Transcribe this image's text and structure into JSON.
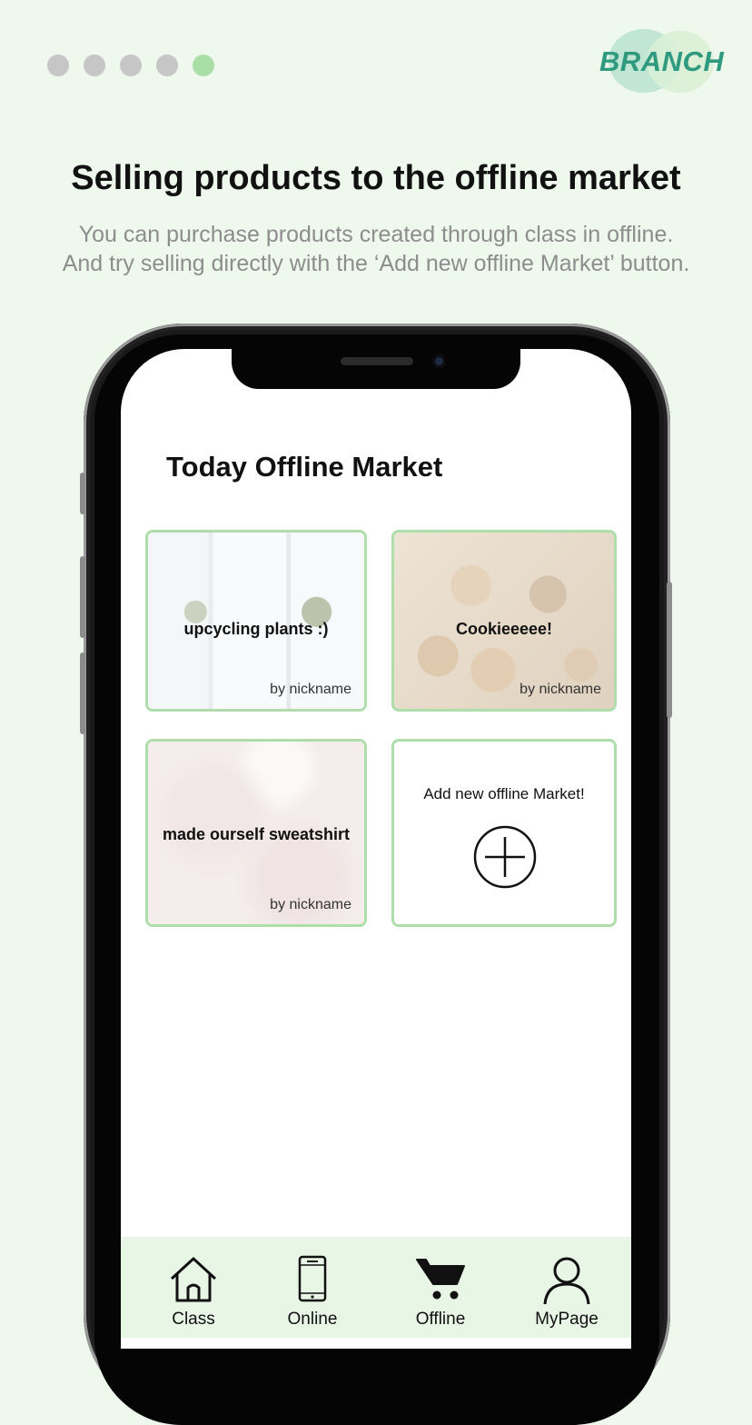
{
  "pager": {
    "count": 5,
    "active_index": 4,
    "colors": {
      "inactive": "#c6c6c6",
      "active": "#a9dfa6"
    }
  },
  "brand": {
    "logo_text": "BRANCH",
    "color": "#2f9a7f"
  },
  "intro": {
    "title": "Selling products to the offline market",
    "line1": "You can purchase products created through class in offline.",
    "line2": "And try selling directly with the ‘Add new offline Market’ button."
  },
  "app": {
    "title": "Today Offline Market",
    "cards": [
      {
        "title": "upcycling plants :)",
        "author": "by nickname",
        "image": "plants-photo"
      },
      {
        "title": "Cookieeeee!",
        "author": "by nickname",
        "image": "cookies-photo"
      },
      {
        "title": "made ourself sweatshirt",
        "author": "by nickname",
        "image": "sweatshirt-photo"
      }
    ],
    "add_card": {
      "label": "Add new offline Market!",
      "icon": "plus-circle-icon"
    },
    "nav": [
      {
        "label": "Class",
        "icon": "home-icon"
      },
      {
        "label": "Online",
        "icon": "smartphone-icon"
      },
      {
        "label": "Offline",
        "icon": "cart-icon",
        "active": true
      },
      {
        "label": "MyPage",
        "icon": "user-icon"
      }
    ]
  },
  "colors": {
    "background": "#eef8ec",
    "card_border": "#aedfab",
    "nav_background": "#e8f6e6"
  }
}
